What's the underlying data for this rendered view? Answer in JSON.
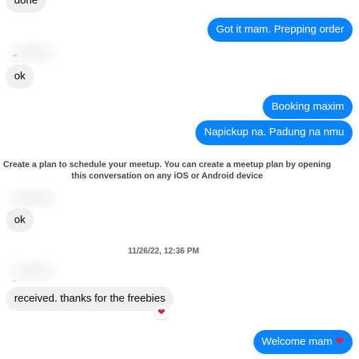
{
  "messages": {
    "m0": "done",
    "m1": "Got it mam. Prepping order",
    "m2": "ok",
    "m3": "Booking maxim",
    "m4": "Napickup na. Padung na nmu",
    "m5": "ok",
    "m6": "received.  thanks for the freebies",
    "m7": "Welcome mam"
  },
  "notice": {
    "line1": "Create a plan to schedule your meetup. You can create a meetup plan by opening",
    "line2": "this conversation on any iOS or Android device"
  },
  "timestamp": "11/26/22, 12:36 PM",
  "icons": {
    "reaction": "heart-icon",
    "inline": "heart-icon",
    "heart_glyph": "❤"
  },
  "colors": {
    "outgoing_bubble": "#0a84ff",
    "incoming_bubble": "#f0f0f0",
    "heart": "#e41e3f"
  }
}
